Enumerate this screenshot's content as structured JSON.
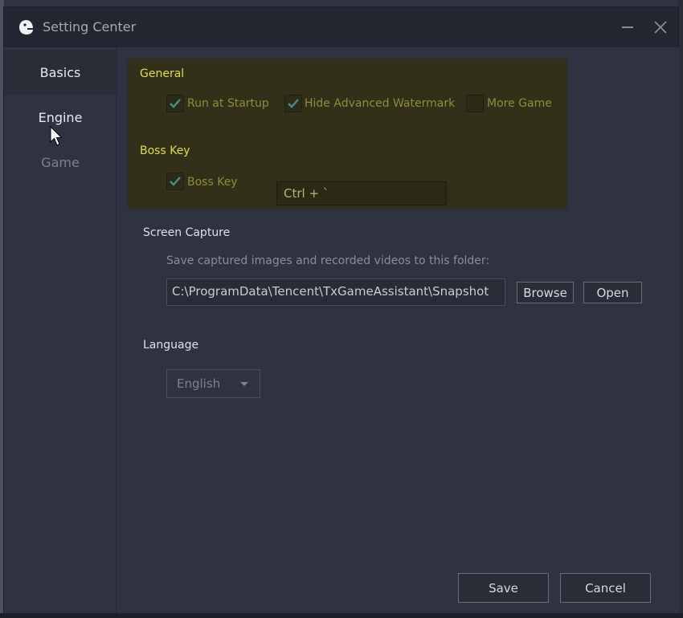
{
  "window": {
    "title": "Setting Center",
    "logo_icon": "app-logo-icon",
    "minimize_icon": "minimize-icon",
    "close_icon": "close-icon"
  },
  "sidebar": {
    "items": [
      {
        "label": "Basics",
        "state": "active"
      },
      {
        "label": "Engine",
        "state": "hover"
      },
      {
        "label": "Game",
        "state": "normal"
      }
    ]
  },
  "general": {
    "title": "General",
    "options": [
      {
        "label": "Run at Startup",
        "checked": true
      },
      {
        "label": "Hide Advanced Watermark",
        "checked": true
      },
      {
        "label": "More Game",
        "checked": false
      }
    ]
  },
  "boss_key": {
    "title": "Boss Key",
    "checkbox_label": "Boss Key",
    "checked": true,
    "hotkey_value": "Ctrl + `"
  },
  "screen_capture": {
    "title": "Screen Capture",
    "hint": "Save captured images and recorded videos to this folder:",
    "path_value": "C:\\ProgramData\\Tencent\\TxGameAssistant\\Snapshot",
    "browse_label": "Browse",
    "open_label": "Open"
  },
  "language": {
    "title": "Language",
    "selected": "English"
  },
  "footer": {
    "save_label": "Save",
    "cancel_label": "Cancel"
  },
  "colors": {
    "highlight_bg": "#323019",
    "highlight_title": "#dede52",
    "window_bg": "#2f3240",
    "titlebar_bg": "#232530"
  }
}
